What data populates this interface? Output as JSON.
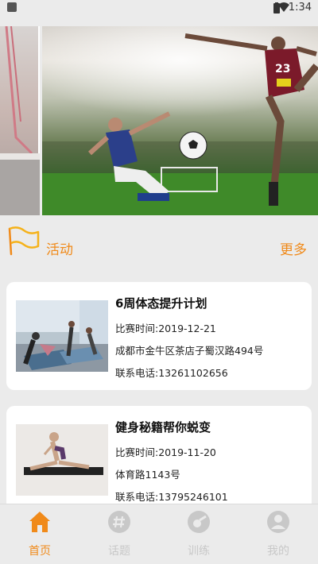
{
  "status_bar": {
    "time": "1:34"
  },
  "section": {
    "title": "活动",
    "more": "更多"
  },
  "cards": [
    {
      "title": "6周体态提升计划",
      "date": "比赛时间:2019-12-21",
      "address": "成都市金牛区茶店子蜀汉路494号",
      "phone": "联系电话:13261102656"
    },
    {
      "title": "健身秘籍帮你蜕变",
      "date": "比赛时间:2019-11-20",
      "address": "体育路1143号",
      "phone": "联系电话:13795246101"
    }
  ],
  "nav": [
    {
      "label": "首页",
      "icon": "home-icon",
      "active": true
    },
    {
      "label": "话题",
      "icon": "hashtag-icon",
      "active": false
    },
    {
      "label": "训练",
      "icon": "whistle-icon",
      "active": false
    },
    {
      "label": "我的",
      "icon": "person-icon",
      "active": false
    }
  ],
  "colors": {
    "accent": "#f08a1a",
    "inactive": "#c8c8c8",
    "background": "#ebebeb"
  }
}
